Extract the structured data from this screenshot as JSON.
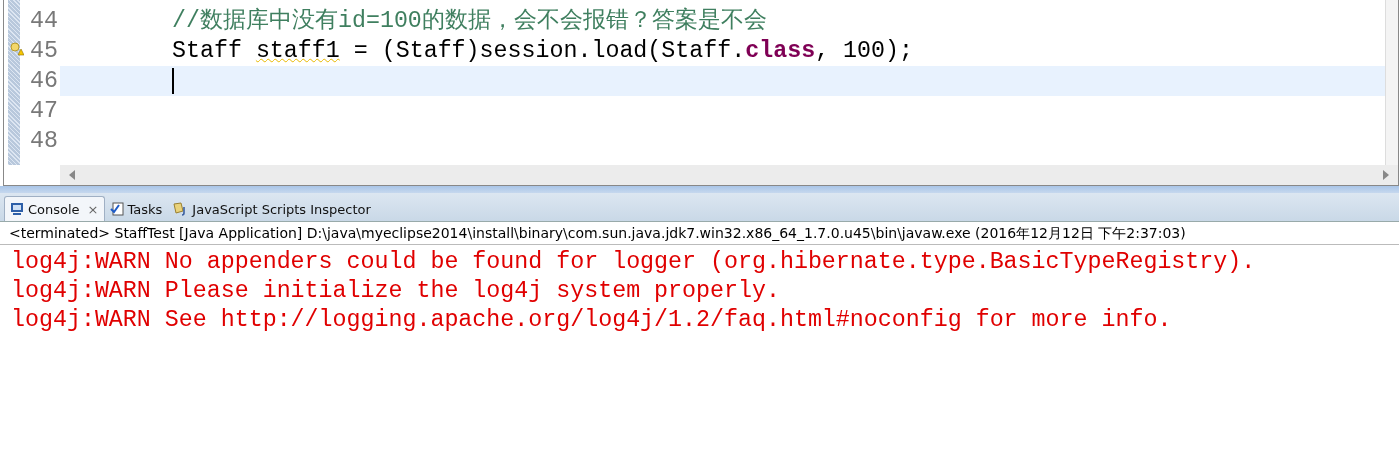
{
  "editor": {
    "lines": [
      {
        "number": "44",
        "current": false,
        "warning": false,
        "caret": false,
        "tokens": [
          {
            "kind": "comment",
            "text": "//数据库中没有id=100的数据，会不会报错？答案是不会"
          }
        ]
      },
      {
        "number": "45",
        "current": false,
        "warning": true,
        "caret": false,
        "tokens": [
          {
            "kind": "plain",
            "text": "Staff "
          },
          {
            "kind": "warn",
            "text": "staff1"
          },
          {
            "kind": "plain",
            "text": " = (Staff)session.load(Staff."
          },
          {
            "kind": "keyword",
            "text": "class"
          },
          {
            "kind": "plain",
            "text": ", 100);"
          }
        ]
      },
      {
        "number": "46",
        "current": true,
        "warning": false,
        "caret": true
      },
      {
        "number": "47",
        "current": false,
        "warning": false,
        "caret": false
      },
      {
        "number": "48",
        "current": false,
        "warning": false,
        "caret": false
      }
    ]
  },
  "tabs": [
    {
      "label": "Console",
      "selected": true,
      "close": "×"
    },
    {
      "label": "Tasks",
      "selected": false
    },
    {
      "label": "JavaScript Scripts Inspector",
      "selected": false
    }
  ],
  "console": {
    "status": "<terminated> StaffTest [Java Application] D:\\java\\myeclipse2014\\install\\binary\\com.sun.java.jdk7.win32.x86_64_1.7.0.u45\\bin\\javaw.exe (2016年12月12日 下午2:37:03)",
    "lines": [
      "log4j:WARN No appenders could be found for logger (org.hibernate.type.BasicTypeRegistry).",
      "log4j:WARN Please initialize the log4j system properly.",
      "log4j:WARN See http://logging.apache.org/log4j/1.2/faq.html#noconfig for more info."
    ]
  }
}
